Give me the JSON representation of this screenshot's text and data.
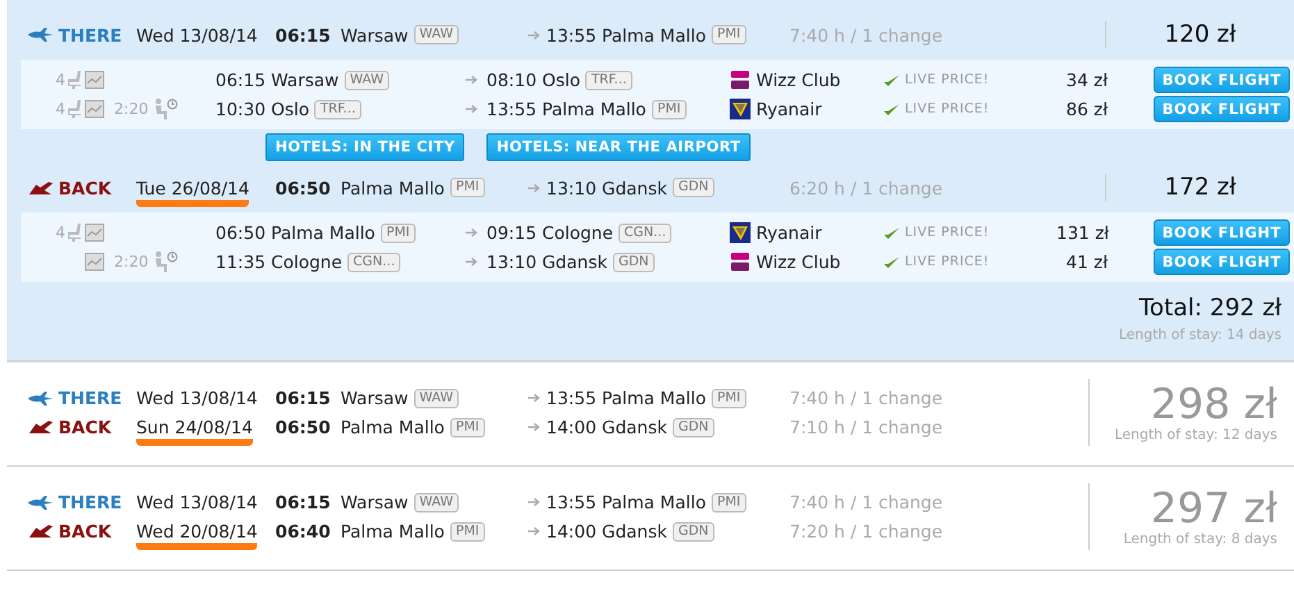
{
  "results": [
    {
      "kind": "expanded",
      "legs": [
        {
          "kind": "there",
          "label": "THERE",
          "date": "Wed 13/08/14",
          "date_marked": false,
          "dep_time": "06:15",
          "dep_city": "Warsaw",
          "dep_code": "WAW",
          "arr_time": "13:55",
          "arr_city": "Palma Mallo",
          "arr_code": "PMI",
          "duration": "7:40 h / 1 change",
          "price": "120 zł",
          "segments": [
            {
              "seats": "4",
              "dep": "06:15 Warsaw",
              "dep_code": "WAW",
              "arr": "08:10 Oslo",
              "arr_code": "TRF...",
              "airline": "Wizz Club",
              "kind": "wizz",
              "live": "LIVE PRICE!",
              "price": "34 zł",
              "button": "BOOK FLIGHT"
            },
            {
              "seats": "4",
              "layover": "2:20",
              "dep": "10:30 Oslo",
              "dep_code": "TRF...",
              "arr": "13:55 Palma Mallo",
              "arr_code": "PMI",
              "airline": "Ryanair",
              "kind": "ryanair",
              "live": "LIVE PRICE!",
              "price": "86 zł",
              "button": "BOOK FLIGHT"
            }
          ]
        },
        {
          "kind": "back",
          "label": "BACK",
          "date": "Tue 26/08/14",
          "date_marked": true,
          "dep_time": "06:50",
          "dep_city": "Palma Mallo",
          "dep_code": "PMI",
          "arr_time": "13:10",
          "arr_city": "Gdansk",
          "arr_code": "GDN",
          "duration": "6:20 h / 1 change",
          "price": "172 zł",
          "segments": [
            {
              "seats": "4",
              "dep": "06:50 Palma Mallo",
              "dep_code": "PMI",
              "arr": "09:15 Cologne",
              "arr_code": "CGN...",
              "airline": "Ryanair",
              "kind": "ryanair",
              "live": "LIVE PRICE!",
              "price": "131 zł",
              "button": "BOOK FLIGHT"
            },
            {
              "layover": "2:20",
              "dep": "11:35 Cologne",
              "dep_code": "CGN...",
              "arr": "13:10 Gdansk",
              "arr_code": "GDN",
              "airline": "Wizz Club",
              "kind": "wizz",
              "live": "LIVE PRICE!",
              "price": "41 zł",
              "button": "BOOK FLIGHT"
            }
          ]
        }
      ],
      "hotel_buttons": [
        "HOTELS: IN THE CITY",
        "HOTELS: NEAR THE AIRPORT"
      ],
      "total": "Total: 292 zł",
      "stay": "Length of stay: 14 days"
    },
    {
      "kind": "collapsed",
      "legs": [
        {
          "kind": "there",
          "label": "THERE",
          "date": "Wed 13/08/14",
          "date_marked": false,
          "dep_time": "06:15",
          "dep_city": "Warsaw",
          "dep_code": "WAW",
          "arr_time": "13:55",
          "arr_city": "Palma Mallo",
          "arr_code": "PMI",
          "duration": "7:40 h / 1 change"
        },
        {
          "kind": "back",
          "label": "BACK",
          "date": "Sun 24/08/14",
          "date_marked": true,
          "dep_time": "06:50",
          "dep_city": "Palma Mallo",
          "dep_code": "PMI",
          "arr_time": "14:00",
          "arr_city": "Gdansk",
          "arr_code": "GDN",
          "duration": "7:10 h / 1 change"
        }
      ],
      "price": "298 zł",
      "stay": "Length of stay: 12 days"
    },
    {
      "kind": "collapsed",
      "legs": [
        {
          "kind": "there",
          "label": "THERE",
          "date": "Wed 13/08/14",
          "date_marked": false,
          "dep_time": "06:15",
          "dep_city": "Warsaw",
          "dep_code": "WAW",
          "arr_time": "13:55",
          "arr_city": "Palma Mallo",
          "arr_code": "PMI",
          "duration": "7:40 h / 1 change"
        },
        {
          "kind": "back",
          "label": "BACK",
          "date": "Wed 20/08/14",
          "date_marked": true,
          "dep_time": "06:40",
          "dep_city": "Palma Mallo",
          "dep_code": "PMI",
          "arr_time": "14:00",
          "arr_city": "Gdansk",
          "arr_code": "GDN",
          "duration": "7:20 h / 1 change"
        }
      ],
      "price": "297 zł",
      "stay": "Length of stay: 8 days"
    }
  ]
}
